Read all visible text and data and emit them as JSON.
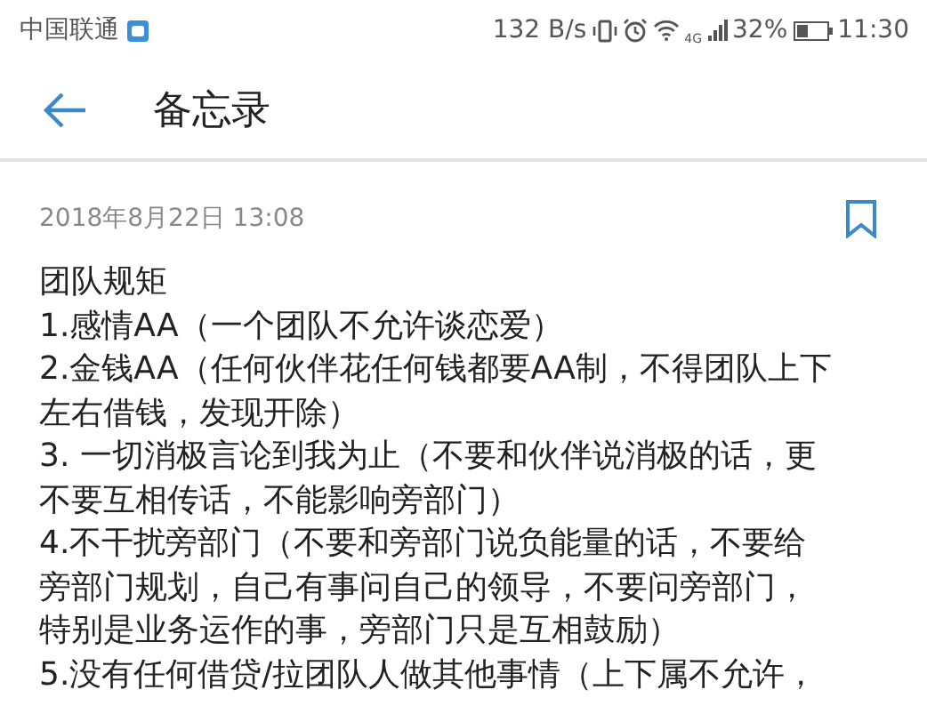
{
  "status_bar": {
    "carrier": "中国联通",
    "speed": "132 B/s",
    "network": "4G",
    "battery": "32%",
    "time": "11:30"
  },
  "header": {
    "title": "备忘录"
  },
  "note": {
    "date": "2018年8月22日 13:08",
    "lines": [
      "团队规矩",
      "1.感情AA（一个团队不允许谈恋爱）",
      "2.金钱AA（任何伙伴花任何钱都要AA制，不得团队上下",
      "左右借钱，发现开除）",
      "3. 一切消极言论到我为止（不要和伙伴说消极的话，更",
      "不要互相传话，不能影响旁部门）",
      "4.不干扰旁部门（不要和旁部门说负能量的话，不要给",
      "旁部门规划，自己有事问自己的领导，不要问旁部门，",
      "特别是业务运作的事，旁部门只是互相鼓励）",
      "5.没有任何借贷/拉团队人做其他事情（上下属不允许，"
    ]
  }
}
